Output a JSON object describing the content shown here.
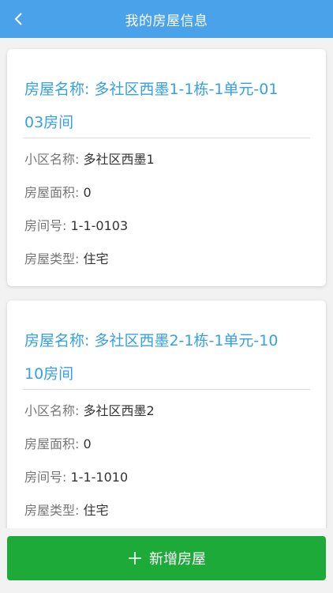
{
  "header": {
    "title": "我的房屋信息",
    "back_icon": "chevron-left-icon"
  },
  "houses": [
    {
      "name_label": "房屋名称:",
      "name_value": "多社区西墨1-1栋-1单元-0103房间",
      "community_label": "小区名称:",
      "community_value": "多社区西墨1",
      "area_label": "房屋面积:",
      "area_value": "0",
      "room_label": "房间号:",
      "room_value": "1-1-0103",
      "type_label": "房屋类型:",
      "type_value": "住宅"
    },
    {
      "name_label": "房屋名称:",
      "name_value": "多社区西墨2-1栋-1单元-1010房间",
      "community_label": "小区名称:",
      "community_value": "多社区西墨2",
      "area_label": "房屋面积:",
      "area_value": "0",
      "room_label": "房间号:",
      "room_value": "1-1-1010",
      "type_label": "房屋类型:",
      "type_value": "住宅"
    }
  ],
  "add_button": {
    "label": "新增房屋",
    "icon": "plus-icon"
  },
  "colors": {
    "header_bg": "#4aa3ea",
    "name_text": "#36a0e3",
    "button_bg": "#1eaa39"
  }
}
